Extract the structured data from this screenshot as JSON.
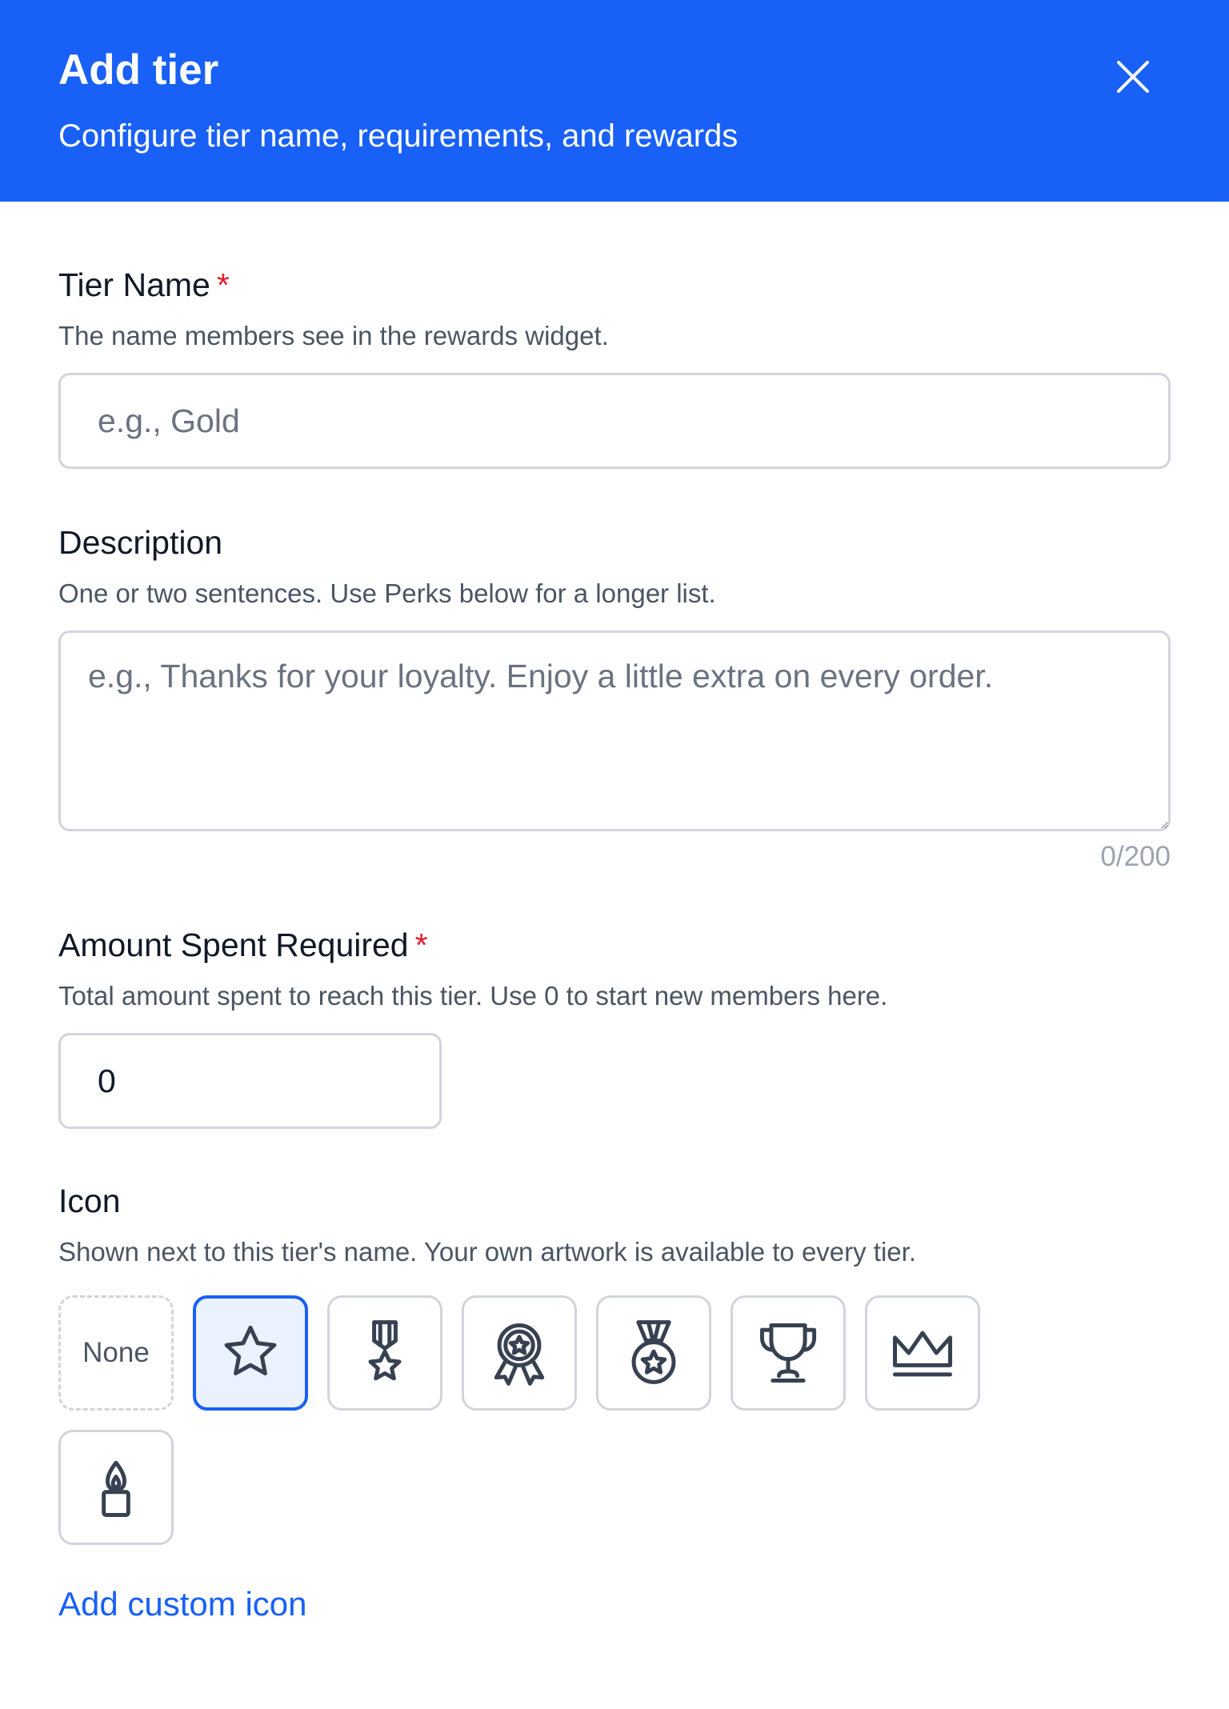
{
  "header": {
    "title": "Add tier",
    "subtitle": "Configure tier name, requirements, and rewards"
  },
  "tier_name": {
    "label": "Tier Name",
    "required": "*",
    "help": "The name members see in the rewards widget.",
    "placeholder": "e.g., Gold",
    "value": ""
  },
  "description": {
    "label": "Description",
    "help": "One or two sentences. Use Perks below for a longer list.",
    "placeholder": "e.g., Thanks for your loyalty. Enjoy a little extra on every order.",
    "value": "",
    "char_count": "0/200"
  },
  "amount_spent": {
    "label": "Amount Spent Required",
    "required": "*",
    "help": "Total amount spent to reach this tier. Use 0 to start new members here.",
    "value": "0"
  },
  "icon": {
    "label": "Icon",
    "help": "Shown next to this tier's name. Your own artwork is available to every tier.",
    "none_label": "None",
    "options": [
      "star-icon",
      "medal-ribbon-icon",
      "award-rosette-icon",
      "medal-icon",
      "trophy-icon",
      "crown-icon",
      "candle-icon"
    ],
    "selected": "star-icon",
    "add_custom_label": "Add custom icon"
  },
  "colors": {
    "primary": "#1860F6",
    "required": "#E11D2E",
    "icon_stroke": "#374151",
    "selected_bg": "#EAF2FF"
  }
}
